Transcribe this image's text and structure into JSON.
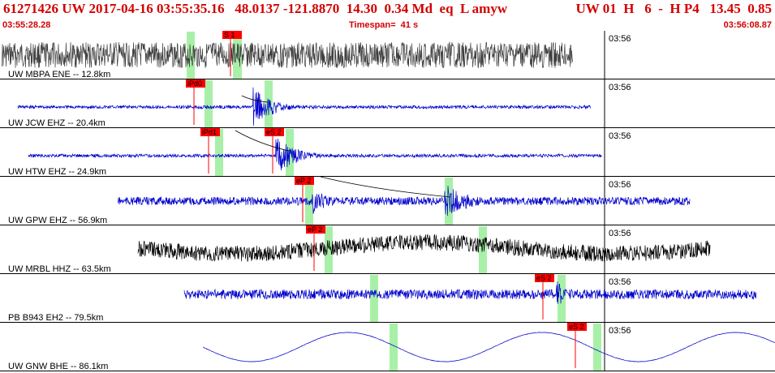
{
  "header": {
    "event_summary": "61271426 UW 2017-04-16 03:55:35.16   48.0137 -121.8870  14.30  0.34 Md  eq  L amyw",
    "pick_summary": "UW 01  H   6  -  H P4   13.45  0.85",
    "start_time": "03:55:28.28",
    "timespan": "Timespan=  41 s",
    "end_time": "03:56:08.87"
  },
  "colors": {
    "header_text": "#d40000",
    "pick_flag": "#ff0000",
    "pick_window": "#a8f0a8",
    "trace_gray": "#404040",
    "trace_blue": "#0000cc",
    "trace_black": "#000000",
    "panel_border": "#000000"
  },
  "panels": [
    {
      "label": "UW MBPA ENE -- 12.8km",
      "tick": "03:56",
      "trace": "gray",
      "picks": [
        "S 1"
      ]
    },
    {
      "label": "UW JCW EHZ -- 20.4km",
      "tick": "03:56",
      "trace": "blue",
      "picks": [
        "iPd0"
      ]
    },
    {
      "label": "UW HTW EHZ -- 24.9km",
      "tick": "03:56",
      "trace": "blue",
      "picks": [
        "iPd1",
        "eS 2"
      ]
    },
    {
      "label": "UW GPW EHZ -- 56.9km",
      "tick": "03:56",
      "trace": "blue",
      "picks": [
        "eP 2"
      ]
    },
    {
      "label": "UW MRBL HHZ -- 63.5km",
      "tick": "03:56",
      "trace": "black",
      "picks": [
        "eP 2"
      ]
    },
    {
      "label": "PB B943 EH2 -- 79.5km",
      "tick": "03:56",
      "trace": "blue",
      "picks": [
        "eS 2"
      ]
    },
    {
      "label": "UW GNW BHE -- 86.1km",
      "tick": "03:56",
      "trace": "blue",
      "picks": [
        "eS 2"
      ]
    }
  ]
}
